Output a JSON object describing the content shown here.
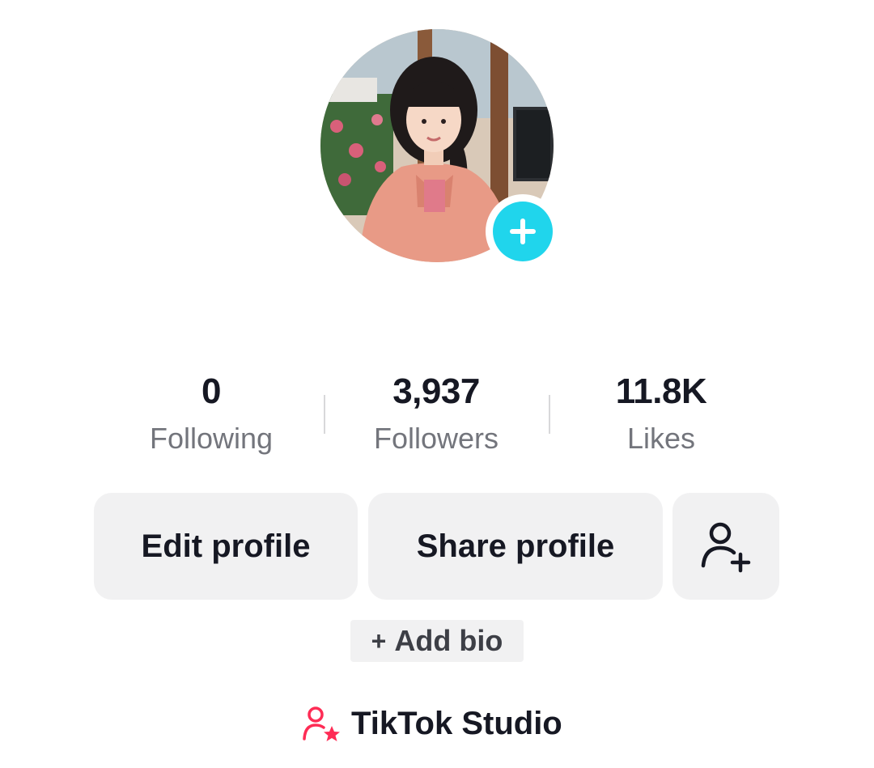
{
  "profile": {
    "avatar_alt": "profile photo",
    "add_avatar_icon": "plus-icon"
  },
  "stats": [
    {
      "value": "0",
      "label": "Following"
    },
    {
      "value": "3,937",
      "label": "Followers"
    },
    {
      "value": "11.8K",
      "label": "Likes"
    }
  ],
  "actions": {
    "edit_label": "Edit profile",
    "share_label": "Share profile",
    "add_friend_icon": "add-user-icon"
  },
  "bio": {
    "plus": "+",
    "add_label": "Add bio"
  },
  "studio": {
    "icon": "person-star-icon",
    "label": "TikTok Studio"
  },
  "colors": {
    "accent_cyan": "#20d5ec",
    "brand_pink": "#fe2c55",
    "button_bg": "#f1f1f2",
    "secondary_text": "#73757c"
  }
}
